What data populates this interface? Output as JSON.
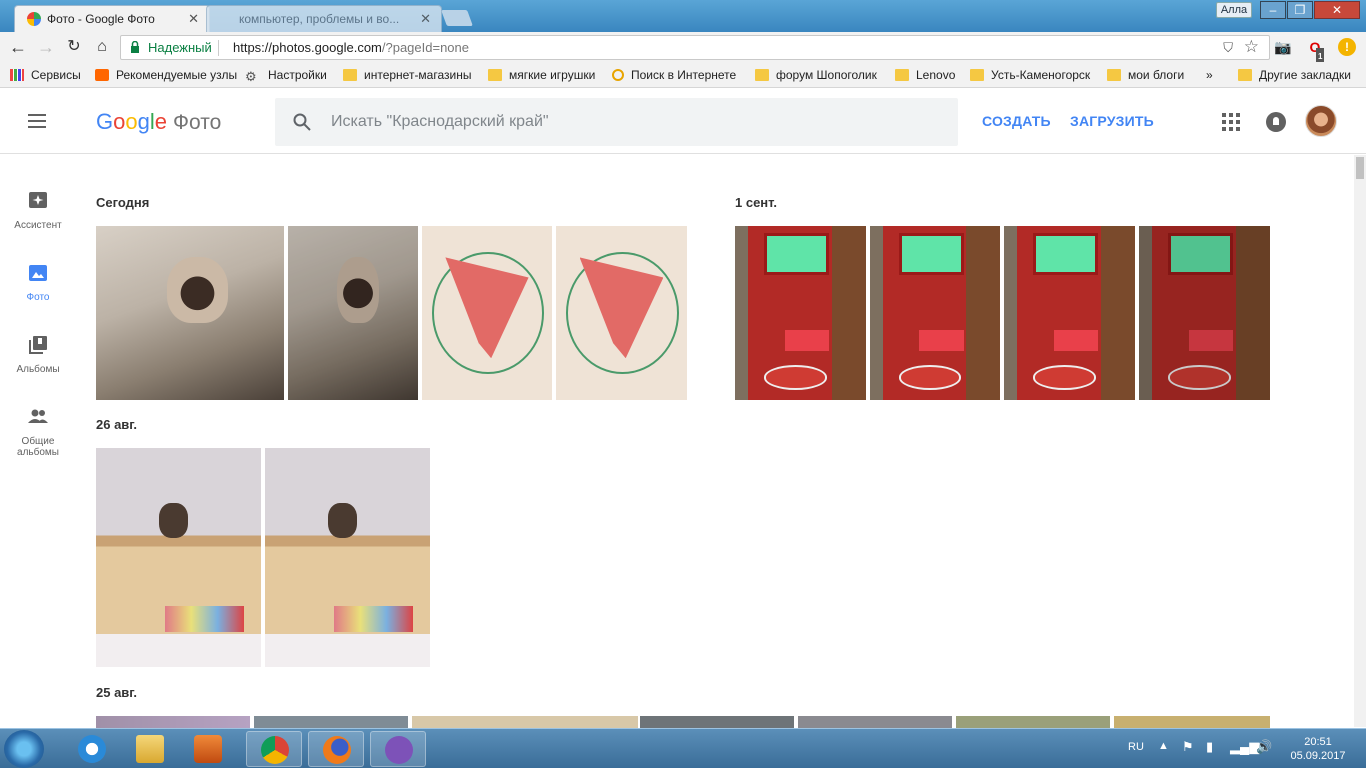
{
  "browser": {
    "active_tab_title": "Фото - Google Фото",
    "inactive_tab_title": "компьютер, проблемы и во...",
    "profile_name": "Алла",
    "secure_label": "Надежный",
    "url_host": "https://photos.google.com",
    "url_rest": "/?pageId=none",
    "extension_badge": "1"
  },
  "bookmarks": {
    "items": [
      "Сервисы",
      "Рекомендуемые узлы",
      "Настройки",
      "интернет-магазины",
      "мягкие игрушки",
      "Поиск в Интернете",
      "форум Шопоголик",
      "Lenovo",
      "Усть-Каменогорск",
      "мои блоги"
    ],
    "overflow": "»",
    "other": "Другие закладки"
  },
  "header": {
    "logo_google": [
      "G",
      "o",
      "o",
      "g",
      "l",
      "e"
    ],
    "logo_product": "Фото",
    "search_placeholder": "Искать \"Краснодарский край\"",
    "create_label": "СОЗДАТЬ",
    "upload_label": "ЗАГРУЗИТЬ"
  },
  "sidebar": {
    "items": [
      {
        "label": "Ассистент",
        "icon": "assistant-icon"
      },
      {
        "label": "Фото",
        "icon": "photos-icon",
        "active": true
      },
      {
        "label": "Альбомы",
        "icon": "albums-icon"
      },
      {
        "label": "Общие альбомы",
        "icon": "shared-albums-icon"
      }
    ]
  },
  "sections": [
    {
      "date": "Сегодня"
    },
    {
      "date": "1 сент."
    },
    {
      "date": "26 авг."
    },
    {
      "date": "25 авг."
    }
  ],
  "taskbar": {
    "lang": "RU",
    "time": "20:51",
    "date": "05.09.2017"
  },
  "colors": {
    "accent": "#4285f4",
    "secure_green": "#0b8043"
  }
}
